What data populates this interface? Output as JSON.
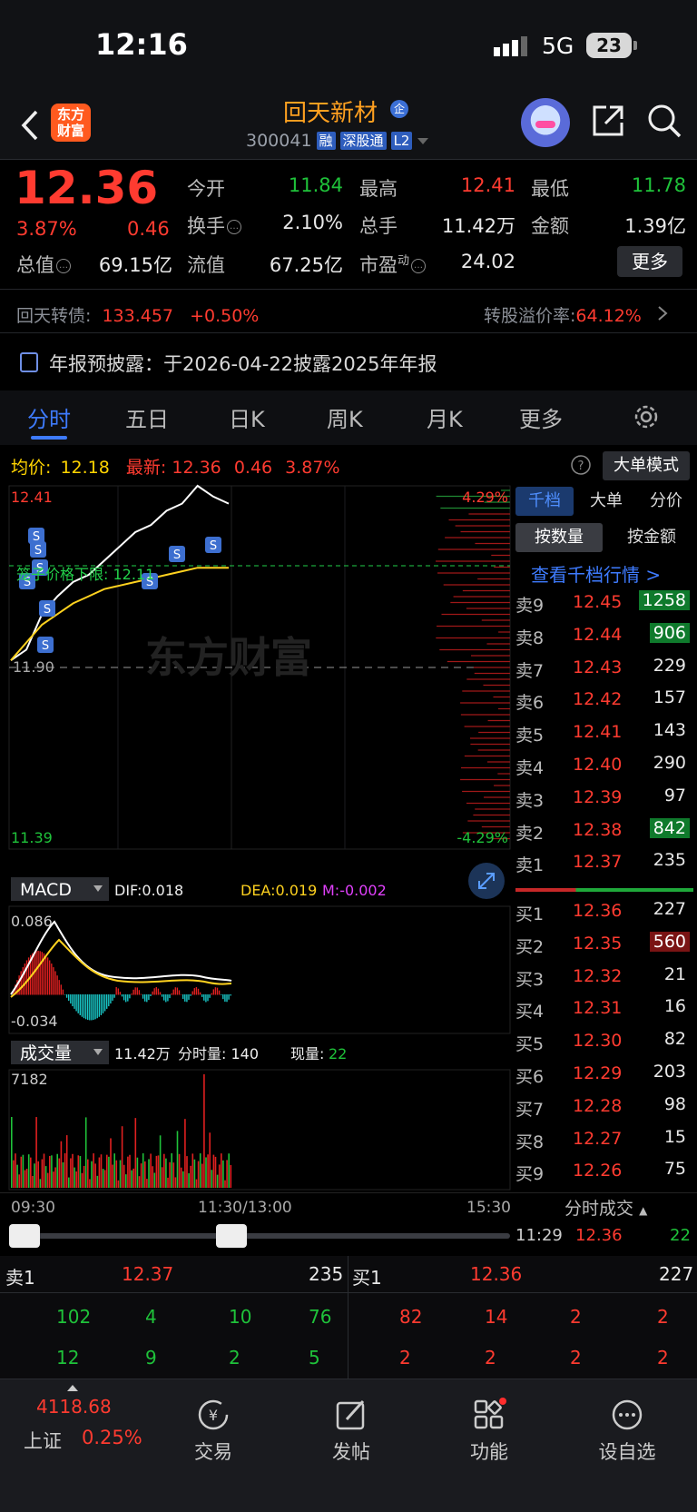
{
  "status_bar": {
    "time": "12:16",
    "network": "5G",
    "battery": "23"
  },
  "header": {
    "logo": "东方财富",
    "stock_name": "回天新材",
    "stock_badge": "企",
    "stock_code": "300041",
    "tags": [
      "融",
      "深股通",
      "L2"
    ]
  },
  "quote": {
    "price": "12.36",
    "change_pct": "3.87%",
    "change": "0.46",
    "open_label": "今开",
    "open": "11.84",
    "high_label": "最高",
    "high": "12.41",
    "low_label": "最低",
    "low": "11.78",
    "turnover_label": "换手",
    "turnover": "2.10%",
    "volume_label": "总手",
    "volume": "11.42万",
    "amount_label": "金额",
    "amount": "1.39亿",
    "mktcap_label": "总值",
    "mktcap": "69.15亿",
    "float_label": "流值",
    "float": "67.25亿",
    "pe_label": "市盈",
    "pe_sup": "动",
    "pe": "24.02",
    "more_button": "更多"
  },
  "bond": {
    "label": "回天转债:",
    "price": "133.457",
    "change": "+0.50%",
    "premium_label": "转股溢价率:",
    "premium": "64.12%"
  },
  "notice": {
    "text": "年报预披露：于2026-04-22披露2025年年报"
  },
  "tabs": [
    "分时",
    "五日",
    "日K",
    "周K",
    "月K",
    "更多"
  ],
  "avg_row": {
    "avg_label": "均价:",
    "avg": "12.18",
    "latest_label": "最新:",
    "latest": "12.36",
    "chg": "0.46",
    "pct": "3.87%"
  },
  "big_order_button": "大单模式",
  "chart_data": {
    "type": "line",
    "x_labels": [
      "09:30",
      "11:30/13:00",
      "15:30"
    ],
    "y_top": "12.41",
    "y_bottom": "11.39",
    "pct_top": "4.29%",
    "pct_bottom": "-4.29%",
    "mid_label": "11.90",
    "limit_label": "笼子价格下限: 12.11",
    "price_series": [
      11.92,
      11.95,
      12.05,
      12.1,
      12.14,
      12.16,
      12.2,
      12.24,
      12.28,
      12.3,
      12.34,
      12.36,
      12.41,
      12.38,
      12.36
    ],
    "avg_series": [
      11.92,
      11.97,
      12.02,
      12.05,
      12.08,
      12.1,
      12.12,
      12.13,
      12.14,
      12.15,
      12.16,
      12.17,
      12.18,
      12.18,
      12.18
    ],
    "macd": {
      "label": "MACD",
      "dif": "DIF:0.018",
      "dea": "DEA:0.019",
      "m": "M:-0.002",
      "top": "0.086",
      "bottom": "-0.034"
    },
    "volume": {
      "label": "成交量",
      "total": "11.42万",
      "tick_label": "分时量: 140",
      "now_label": "现量:",
      "now": "22",
      "max": "7182"
    }
  },
  "orderbook": {
    "tabs": [
      "千档",
      "大单",
      "分价"
    ],
    "seg": [
      "按数量",
      "按金额"
    ],
    "link": "查看千档行情 >",
    "asks": [
      {
        "label": "卖9",
        "price": "12.45",
        "qty": "1258",
        "hl": true
      },
      {
        "label": "卖8",
        "price": "12.44",
        "qty": "906",
        "hl": true
      },
      {
        "label": "卖7",
        "price": "12.43",
        "qty": "229",
        "hl": false
      },
      {
        "label": "卖6",
        "price": "12.42",
        "qty": "157",
        "hl": false
      },
      {
        "label": "卖5",
        "price": "12.41",
        "qty": "143",
        "hl": false
      },
      {
        "label": "卖4",
        "price": "12.40",
        "qty": "290",
        "hl": false
      },
      {
        "label": "卖3",
        "price": "12.39",
        "qty": "97",
        "hl": false
      },
      {
        "label": "卖2",
        "price": "12.38",
        "qty": "842",
        "hl": true
      },
      {
        "label": "卖1",
        "price": "12.37",
        "qty": "235",
        "hl": false
      }
    ],
    "bids": [
      {
        "label": "买1",
        "price": "12.36",
        "qty": "227"
      },
      {
        "label": "买2",
        "price": "12.35",
        "qty": "560"
      },
      {
        "label": "买3",
        "price": "12.32",
        "qty": "21"
      },
      {
        "label": "买4",
        "price": "12.31",
        "qty": "16"
      },
      {
        "label": "买5",
        "price": "12.30",
        "qty": "82"
      },
      {
        "label": "买6",
        "price": "12.29",
        "qty": "203"
      },
      {
        "label": "买7",
        "price": "12.28",
        "qty": "98"
      },
      {
        "label": "买8",
        "price": "12.27",
        "qty": "15"
      },
      {
        "label": "买9",
        "price": "12.26",
        "qty": "75"
      }
    ],
    "trades_label": "分时成交",
    "trade": {
      "time": "11:29",
      "price": "12.36",
      "qty": "22"
    }
  },
  "quick_book": {
    "sell_label": "卖1",
    "sell_price": "12.37",
    "sell_qty": "235",
    "buy_label": "买1",
    "buy_price": "12.36",
    "buy_qty": "227",
    "sell_row1": [
      "102",
      "4",
      "10",
      "76"
    ],
    "sell_row2": [
      "12",
      "9",
      "2",
      "5"
    ],
    "buy_row1": [
      "82",
      "14",
      "2",
      "2"
    ],
    "buy_row2": [
      "2",
      "2",
      "2",
      "2"
    ]
  },
  "nav": {
    "index_value": "4118.68",
    "index_name": "上证",
    "index_pct": "0.25%",
    "items": [
      "交易",
      "发帖",
      "功能",
      "设自选"
    ]
  }
}
